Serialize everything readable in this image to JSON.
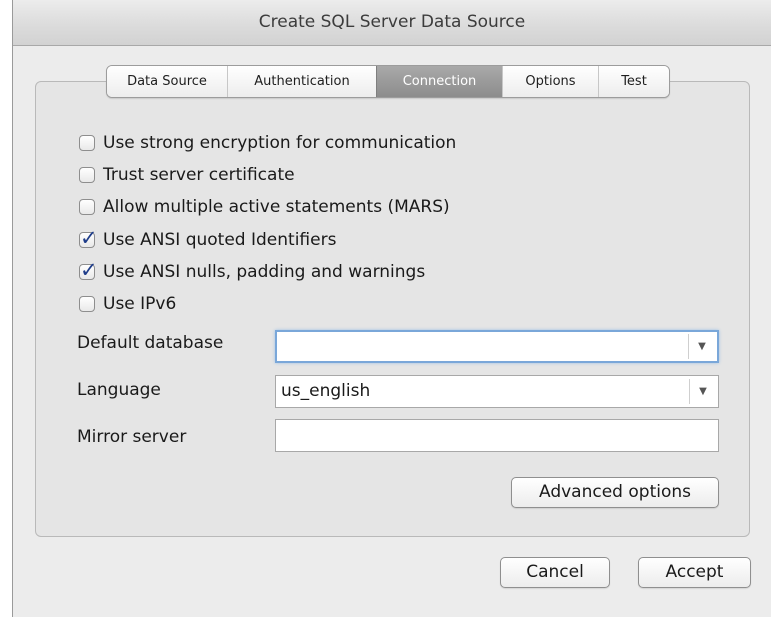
{
  "window": {
    "title": "Create SQL Server Data Source"
  },
  "tabs": [
    {
      "label": "Data Source",
      "active": false
    },
    {
      "label": "Authentication",
      "active": false
    },
    {
      "label": "Connection",
      "active": true
    },
    {
      "label": "Options",
      "active": false
    },
    {
      "label": "Test",
      "active": false
    }
  ],
  "options": [
    {
      "label": "Use strong encryption for communication",
      "checked": false
    },
    {
      "label": "Trust server certificate",
      "checked": false
    },
    {
      "label": "Allow multiple active statements (MARS)",
      "checked": false
    },
    {
      "label": "Use ANSI quoted Identifiers",
      "checked": true
    },
    {
      "label": "Use ANSI nulls, padding and warnings",
      "checked": true
    },
    {
      "label": "Use IPv6",
      "checked": false
    }
  ],
  "fields": {
    "default_database": {
      "label": "Default database",
      "value": ""
    },
    "language": {
      "label": "Language",
      "value": "us_english"
    },
    "mirror_server": {
      "label": "Mirror server",
      "value": ""
    }
  },
  "buttons": {
    "advanced": "Advanced options",
    "cancel": "Cancel",
    "accept": "Accept"
  },
  "colors": {
    "accent_check": "#1f3d8a",
    "active_tab": "#8c8c8c",
    "focus_ring": "#7aa7d9"
  }
}
